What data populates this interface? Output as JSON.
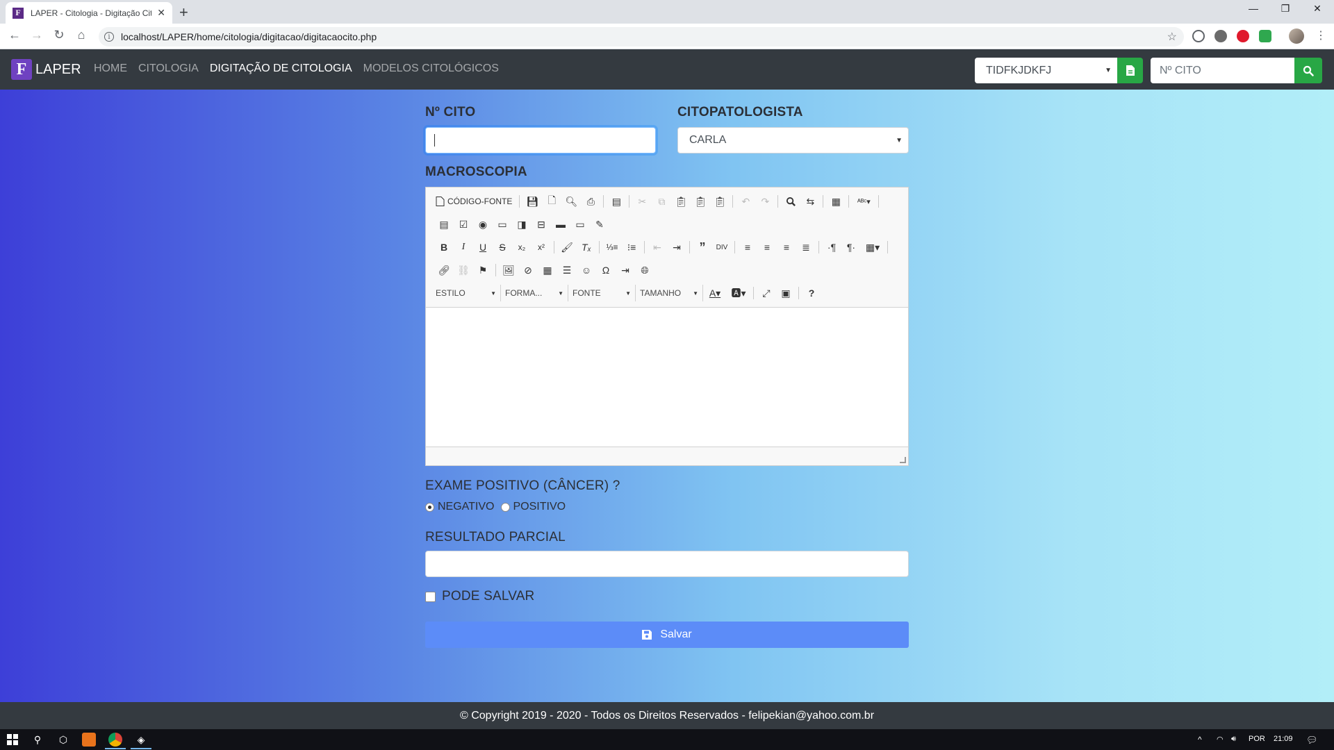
{
  "browser": {
    "tab_title": "LAPER - Citologia - Digitação Cit",
    "favicon_letter": "F",
    "url": "localhost/LAPER/home/citologia/digitacao/digitacaocito.php"
  },
  "navbar": {
    "brand_letter": "F",
    "brand": "LAPER",
    "links": [
      {
        "label": "HOME",
        "active": false
      },
      {
        "label": "CITOLOGIA",
        "active": false
      },
      {
        "label": "DIGITAÇÃO DE CITOLOGIA",
        "active": true
      },
      {
        "label": "MODELOS CITOLÓGICOS",
        "active": false
      }
    ],
    "select_value": "TIDFKJDKFJ",
    "search_placeholder": "Nº CITO",
    "accent_color": "#28a745"
  },
  "form": {
    "cito_label": "Nº CITO",
    "cito_value": "",
    "citopatologista_label": "CITOPATOLOGISTA",
    "citopatologista_value": "CARLA",
    "macroscopia_label": "MACROSCOPIA",
    "editor": {
      "source_label": "CÓDIGO-FONTE",
      "combos": [
        "ESTILO",
        "FORMA...",
        "FONTE",
        "TAMANHO"
      ],
      "content": ""
    },
    "exame_label": "EXAME POSITIVO (CÂNCER) ?",
    "radio_negativo": "NEGATIVO",
    "radio_positivo": "POSITIVO",
    "radio_selected": "NEGATIVO",
    "resultado_label": "RESULTADO PARCIAL",
    "resultado_value": "",
    "pode_salvar_label": "PODE SALVAR",
    "pode_salvar_checked": false,
    "save_label": "Salvar",
    "save_color": "#5c8cf8"
  },
  "footer": {
    "text": "© Copyright 2019 - 2020 - Todos os Direitos Reservados - felipekian@yahoo.com.br"
  },
  "taskbar": {
    "language": "POR",
    "time": "21:09"
  }
}
